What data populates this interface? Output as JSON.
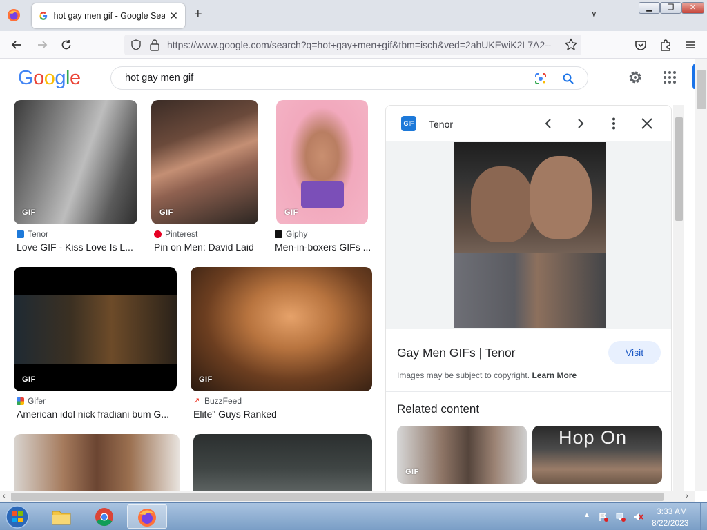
{
  "browser": {
    "tab_title": "hot gay men gif - Google Search",
    "url": "https://www.google.com/search?q=hot+gay+men+gif&tbm=isch&ved=2ahUKEwiK2L7A2--"
  },
  "google": {
    "logo": "Google",
    "query": "hot gay men gif"
  },
  "results": [
    {
      "source": "Tenor",
      "title": "Love GIF - Kiss Love Is L...",
      "badge": "GIF"
    },
    {
      "source": "Pinterest",
      "title": "Pin on Men: David Laid",
      "badge": "GIF"
    },
    {
      "source": "Giphy",
      "title": "Men-in-boxers GIFs ...",
      "badge": "GIF"
    },
    {
      "source": "Gifer",
      "title": "American idol nick fradiani bum G...",
      "badge": "GIF"
    },
    {
      "source": "BuzzFeed",
      "title": "Elite\" Guys Ranked",
      "badge": "GIF"
    }
  ],
  "panel": {
    "source": "Tenor",
    "tenor_logo": "GIF",
    "title": "Gay Men GIFs | Tenor",
    "visit_label": "Visit",
    "copyright_text": "Images may be subject to copyright.",
    "learn_more": "Learn More",
    "related_title": "Related content",
    "related": [
      {
        "badge": "GIF",
        "caption": ""
      },
      {
        "badge": "",
        "caption": "Hop On"
      }
    ]
  },
  "taskbar": {
    "time": "3:33 AM",
    "date": "8/22/2023"
  },
  "colors": {
    "google_blue": "#4285F4",
    "google_red": "#EA4335",
    "google_yellow": "#FBBC05",
    "google_green": "#34A853",
    "accent_blue": "#1a73e8"
  }
}
